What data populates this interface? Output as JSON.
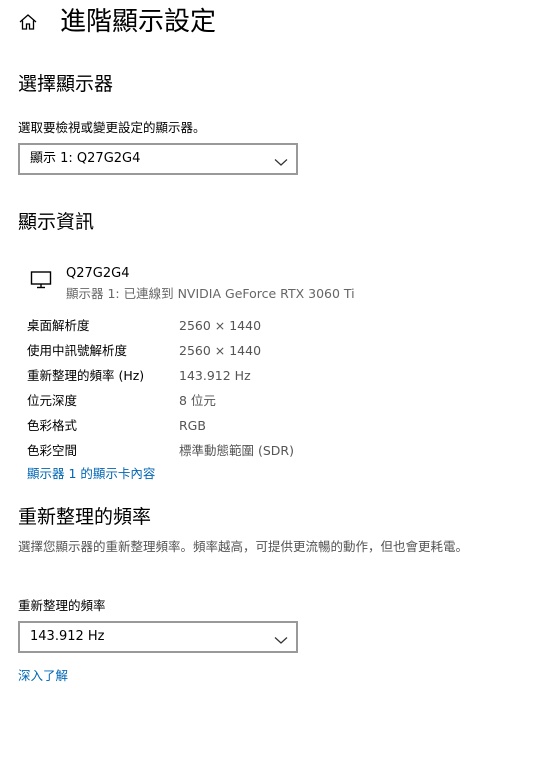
{
  "header": {
    "title": "進階顯示設定",
    "home_icon": "home-icon"
  },
  "select_display": {
    "heading": "選擇顯示器",
    "label": "選取要檢視或變更設定的顯示器。",
    "selected": "顯示 1: Q27G2G4"
  },
  "display_info": {
    "heading": "顯示資訊",
    "monitor_icon": "monitor-icon",
    "name": "Q27G2G4",
    "subtitle": "顯示器 1: 已連線到 NVIDIA GeForce RTX 3060 Ti",
    "rows": [
      {
        "label": "桌面解析度",
        "value": "2560 × 1440"
      },
      {
        "label": "使用中訊號解析度",
        "value": "2560 × 1440"
      },
      {
        "label": "重新整理的頻率 (Hz)",
        "value": "143.912 Hz"
      },
      {
        "label": "位元深度",
        "value": "8 位元"
      },
      {
        "label": "色彩格式",
        "value": "RGB"
      },
      {
        "label": "色彩空間",
        "value": "標準動態範圍 (SDR)"
      }
    ],
    "adapter_link": "顯示器 1 的顯示卡內容"
  },
  "refresh_rate": {
    "heading": "重新整理的頻率",
    "description": "選擇您顯示器的重新整理頻率。頻率越高，可提供更流暢的動作，但也會更耗電。",
    "label": "重新整理的頻率",
    "selected": "143.912 Hz",
    "learn_more": "深入了解"
  },
  "colors": {
    "link": "#0066b4",
    "dropdown_border": "#999999",
    "secondary_text": "#555555"
  }
}
